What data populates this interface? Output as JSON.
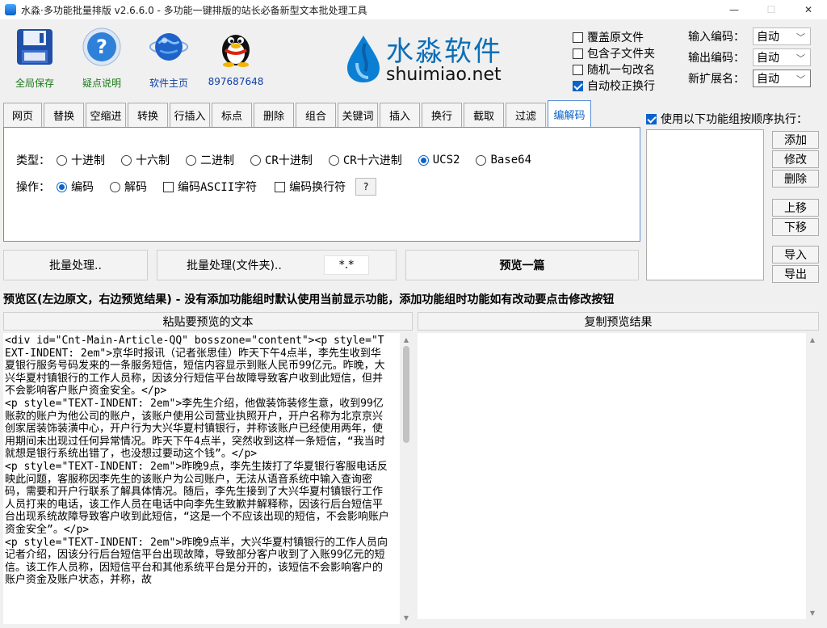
{
  "window": {
    "title": "水淼·多功能批量排版 v2.6.6.0 - 多功能一键排版的站长必备新型文本批处理工具",
    "minimize": "—",
    "maximize": "☐",
    "close": "✕"
  },
  "toolbar": {
    "save_label": "全局保存",
    "help_label": "疑点说明",
    "home_label": "软件主页",
    "qq_label": "897687648"
  },
  "logo": {
    "cn": "水淼软件",
    "en": "shuimiao.net"
  },
  "options": {
    "overwrite": {
      "label": "覆盖原文件",
      "checked": false
    },
    "subfolders": {
      "label": "包含子文件夹",
      "checked": false
    },
    "random_rename": {
      "label": "随机一句改名",
      "checked": false
    },
    "auto_linebreak": {
      "label": "自动校正换行",
      "checked": true
    }
  },
  "encoding": {
    "input_label": "输入编码：",
    "input_value": "自动",
    "output_label": "输出编码：",
    "output_value": "自动",
    "ext_label": "新扩展名：",
    "ext_value": "自动"
  },
  "tabs": [
    "网页",
    "替换",
    "空缩进",
    "转换",
    "行插入",
    "标点",
    "删除",
    "组合",
    "关键词",
    "插入",
    "换行",
    "截取",
    "过滤",
    "编解码"
  ],
  "active_tab": "编解码",
  "panel": {
    "type_label": "类型：",
    "types": [
      {
        "label": "十进制",
        "selected": false
      },
      {
        "label": "十六制",
        "selected": false
      },
      {
        "label": "二进制",
        "selected": false
      },
      {
        "label": "CR十进制",
        "selected": false
      },
      {
        "label": "CR十六进制",
        "selected": false
      },
      {
        "label": "UCS2",
        "selected": true
      },
      {
        "label": "Base64",
        "selected": false
      }
    ],
    "op_label": "操作：",
    "ops": [
      {
        "label": "编码",
        "selected": true
      },
      {
        "label": "解码",
        "selected": false
      }
    ],
    "encode_ascii": {
      "label": "编码ASCII字符",
      "checked": false
    },
    "encode_newline": {
      "label": "编码换行符",
      "checked": false
    },
    "help_btn": "?"
  },
  "sequence": {
    "label": "使用以下功能组按顺序执行：",
    "checked": true,
    "buttons": {
      "add": "添加",
      "modify": "修改",
      "delete": "删除",
      "up": "上移",
      "down": "下移",
      "import": "导入",
      "export": "导出"
    }
  },
  "actions": {
    "batch": "批量处理..",
    "batch_folder": "批量处理(文件夹)..",
    "pattern": "*.*",
    "preview": "预览一篇"
  },
  "notice": "预览区(左边原文，右边预览结果) - 没有添加功能组时默认使用当前显示功能，添加功能组时功能如有改动要点击修改按钮",
  "preview": {
    "paste_btn": "粘贴要预览的文本",
    "copy_btn": "复制预览结果",
    "source_text": "<div id=\"Cnt-Main-Article-QQ\" bosszone=\"content\"><p style=\"TEXT-INDENT: 2em\">京华时报讯（记者张思佳）昨天下午4点半，李先生收到华夏银行服务号码发来的一条服务短信，短信内容显示到账人民币99亿元。昨晚，大兴华夏村镇银行的工作人员称，因该分行短信平台故障导致客户收到此短信，但并不会影响客户账户资金安全。</p>\n<p style=\"TEXT-INDENT: 2em\">李先生介绍，他做装饰装修生意，收到99亿账款的账户为他公司的账户，该账户使用公司营业执照开户，开户名称为北京京兴创家居装饰装潢中心，开户行为大兴华夏村镇银行，并称该账户已经使用两年，使用期间未出现过任何异常情况。昨天下午4点半，突然收到这样一条短信，“我当时就想是银行系统出错了，也没想过要动这个钱”。</p>\n<p style=\"TEXT-INDENT: 2em\">昨晚9点，李先生拨打了华夏银行客服电话反映此问题，客服称因李先生的该账户为公司账户，无法从语音系统中输入查询密码，需要和开户行联系了解具体情况。随后，李先生接到了大兴华夏村镇银行工作人员打来的电话，该工作人员在电话中向李先生致歉并解释称，因该行后台短信平台出现系统故障导致客户收到此短信，“这是一个不应该出现的短信，不会影响账户资金安全”。</p>\n<p style=\"TEXT-INDENT: 2em\">昨晚9点半，大兴华夏村镇银行的工作人员向记者介绍，因该分行后台短信平台出现故障，导致部分客户收到了入账99亿元的短信。该工作人员称，因短信平台和其他系统平台是分开的，该短信不会影响客户的账户资金及账户状态，并称，故",
    "result_text": ""
  }
}
